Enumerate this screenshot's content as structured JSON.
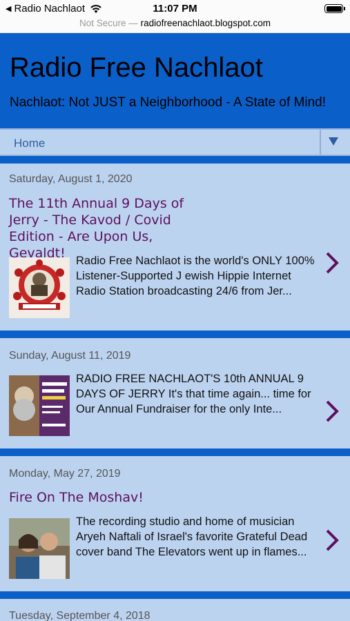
{
  "status_bar": {
    "back_app": "Radio Nachlaot",
    "time": "11:07 PM"
  },
  "url_bar": {
    "security": "Not Secure",
    "separator": "—",
    "domain": "radiofreenachlaot.blogspot.com"
  },
  "header": {
    "title": "Radio Free Nachlaot",
    "description": "Nachlaot: Not JUST a Neighborhood - A State of Mind!"
  },
  "nav": {
    "home": "Home"
  },
  "posts": [
    {
      "date": "Saturday, August 1, 2020",
      "title": "The 11th Annual 9 Days of Jerry - The Kavod / Covid Edition - Are Upon Us, Gevaldt!",
      "snippet": "Radio Free Nachlaot   is the world's ONLY 100% Listener-Supported J ewish Hippie Internet Radio Station broadcasting 24/6 from Jer..."
    },
    {
      "date": "Sunday, August 11, 2019",
      "title": "",
      "snippet": "RADIO FREE NACHLAOT'S  10th ANNUAL  9 DAYS OF JERRY   It's that time again... time for Our Annual Fundraiser for the only Inte..."
    },
    {
      "date": "Monday, May 27, 2019",
      "title": "Fire On The Moshav!",
      "snippet": "The recording studio and home of musician Aryeh Naftali of Israel's favorite Grateful Dead cover band The Elevators went up in flames..."
    },
    {
      "date": "Tuesday, September 4, 2018"
    }
  ],
  "colors": {
    "header_bg": "#0a5fc9",
    "page_bg": "#bcd3f0",
    "post_title": "#5e0f5e",
    "chevron": "#5e0f5e"
  }
}
